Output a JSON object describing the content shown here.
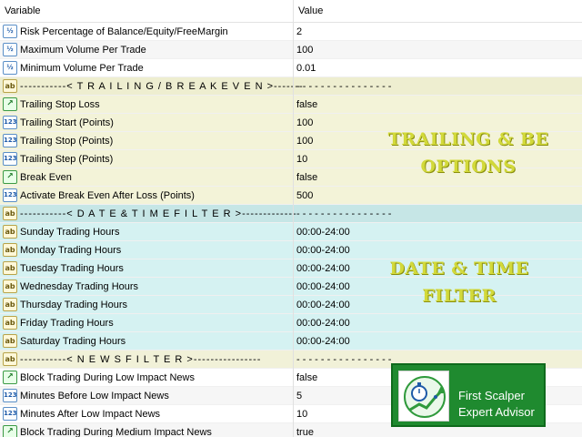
{
  "header": {
    "variable": "Variable",
    "value": "Value"
  },
  "rows": [
    {
      "icon": "fraction-icon",
      "glyph": "½",
      "name": "Risk Percentage of Balance/Equity/FreeMargin",
      "value": "2",
      "style": "plain"
    },
    {
      "icon": "fraction-icon",
      "glyph": "½",
      "name": "Maximum Volume Per Trade",
      "value": "100",
      "style": "alt"
    },
    {
      "icon": "fraction-icon",
      "glyph": "½",
      "name": "Minimum Volume Per Trade",
      "value": "0.01",
      "style": "plain"
    },
    {
      "icon": "string-icon",
      "glyph": "ab",
      "name": "-----------< T R A I L I N G   /   B R E A K E V E N >-------",
      "value": "- - - - - - - - - - - - - - - -",
      "style": "trail-hdr"
    },
    {
      "icon": "bool-icon",
      "glyph": "↗",
      "name": "Trailing Stop Loss",
      "value": "false",
      "style": "trail"
    },
    {
      "icon": "integer-icon",
      "glyph": "123",
      "name": "Trailing Start (Points)",
      "value": "100",
      "style": "trail"
    },
    {
      "icon": "integer-icon",
      "glyph": "123",
      "name": "Trailing Stop (Points)",
      "value": "100",
      "style": "trail"
    },
    {
      "icon": "integer-icon",
      "glyph": "123",
      "name": "Trailing Step (Points)",
      "value": "10",
      "style": "trail"
    },
    {
      "icon": "bool-icon",
      "glyph": "↗",
      "name": "Break Even",
      "value": "false",
      "style": "trail"
    },
    {
      "icon": "integer-icon",
      "glyph": "123",
      "name": "Activate Break Even After Loss (Points)",
      "value": "500",
      "style": "trail"
    },
    {
      "icon": "string-icon",
      "glyph": "ab",
      "name": "-----------< D A T E  &  T I M E  F I L T E R >-------------",
      "value": "- - - - - - - - - - - - - - - -",
      "style": "date-hdr"
    },
    {
      "icon": "string-icon",
      "glyph": "ab",
      "name": "Sunday Trading Hours",
      "value": "00:00-24:00",
      "style": "date"
    },
    {
      "icon": "string-icon",
      "glyph": "ab",
      "name": "Monday Trading Hours",
      "value": "00:00-24:00",
      "style": "date"
    },
    {
      "icon": "string-icon",
      "glyph": "ab",
      "name": "Tuesday Trading Hours",
      "value": "00:00-24:00",
      "style": "date"
    },
    {
      "icon": "string-icon",
      "glyph": "ab",
      "name": "Wednesday Trading Hours",
      "value": "00:00-24:00",
      "style": "date"
    },
    {
      "icon": "string-icon",
      "glyph": "ab",
      "name": "Thursday Trading Hours",
      "value": "00:00-24:00",
      "style": "date"
    },
    {
      "icon": "string-icon",
      "glyph": "ab",
      "name": "Friday Trading Hours",
      "value": "00:00-24:00",
      "style": "date"
    },
    {
      "icon": "string-icon",
      "glyph": "ab",
      "name": "Saturday Trading Hours",
      "value": "00:00-24:00",
      "style": "date"
    },
    {
      "icon": "string-icon",
      "glyph": "ab",
      "name": "-----------< N E W S  F I L T E R >----------------",
      "value": "- - - - - - - - - - - - - - - -",
      "style": "news-hdr"
    },
    {
      "icon": "bool-icon",
      "glyph": "↗",
      "name": "Block Trading During Low Impact News",
      "value": "false",
      "style": "plain"
    },
    {
      "icon": "integer-icon",
      "glyph": "123",
      "name": "Minutes Before Low Impact News",
      "value": "5",
      "style": "alt"
    },
    {
      "icon": "integer-icon",
      "glyph": "123",
      "name": "Minutes After Low Impact News",
      "value": "10",
      "style": "plain"
    },
    {
      "icon": "bool-icon",
      "glyph": "↗",
      "name": "Block Trading During Medium Impact News",
      "value": "true",
      "style": "alt"
    }
  ],
  "overlays": {
    "trailing_line1": "TRAILING & BE",
    "trailing_line2": "OPTIONS",
    "date_line1": "DATE & TIME",
    "date_line2": "FILTER"
  },
  "badge": {
    "line1": "First Scalper",
    "line2": "Expert Advisor",
    "logo_icon": "stopwatch-chart-icon"
  }
}
